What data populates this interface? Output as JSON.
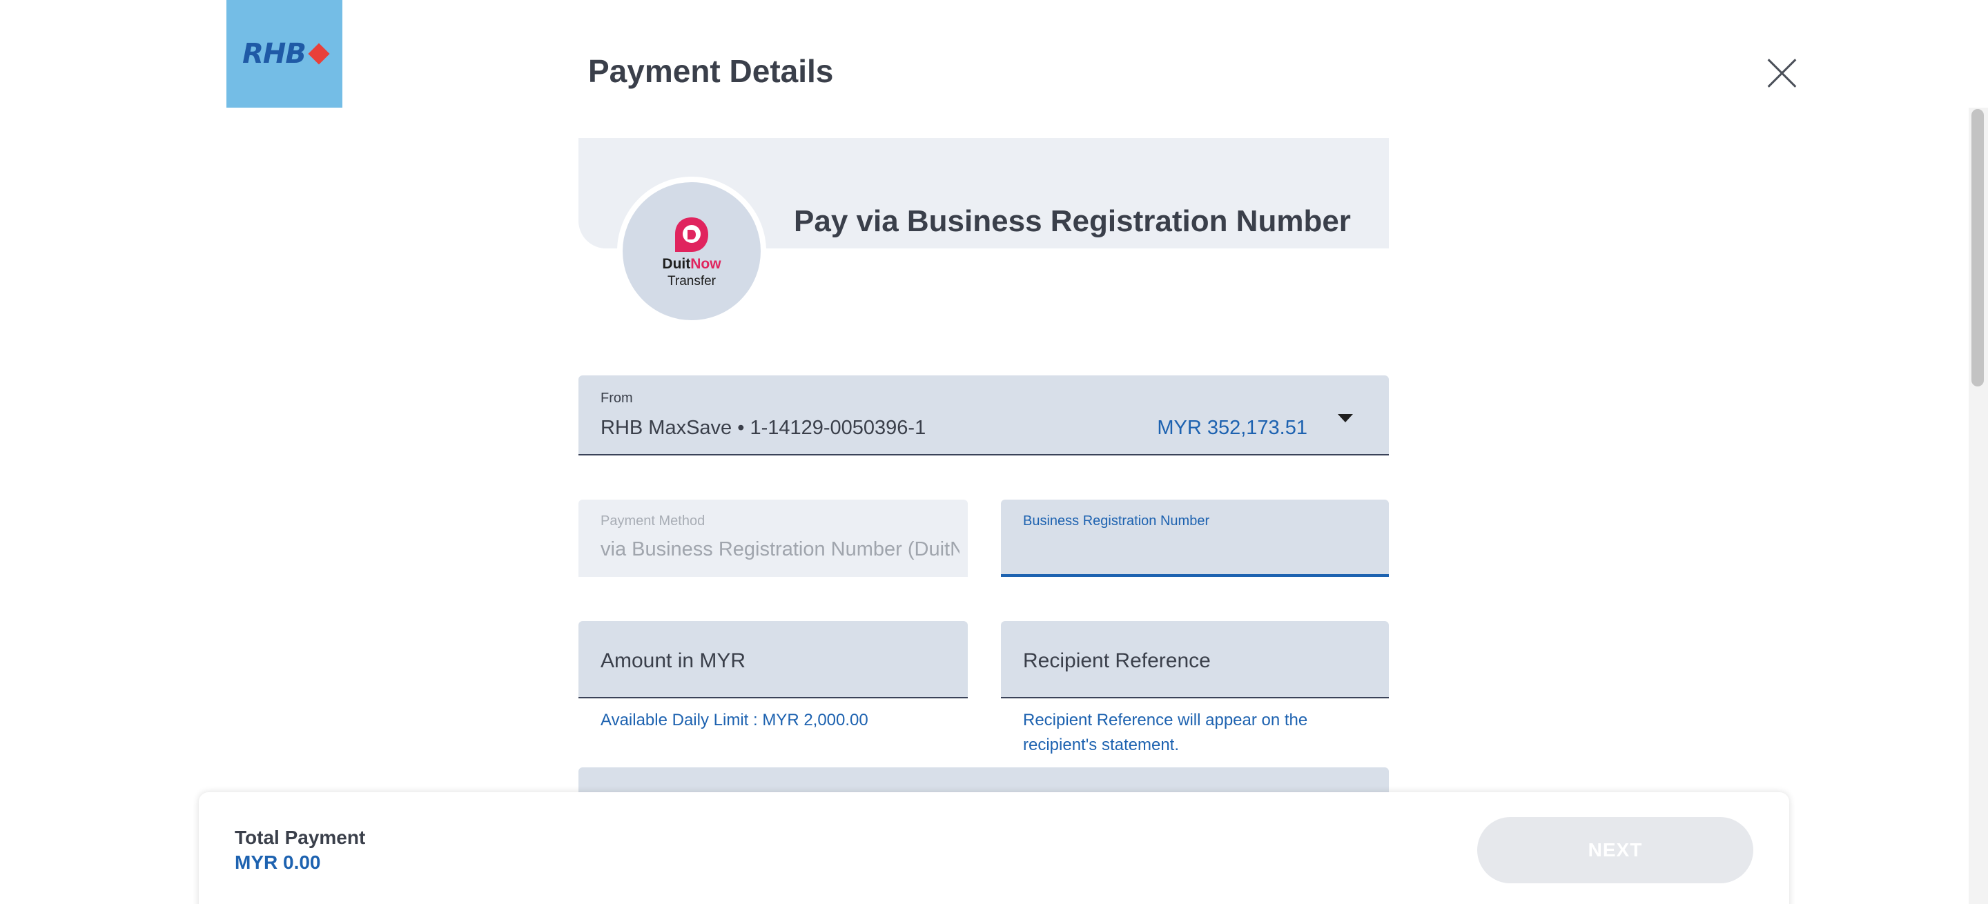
{
  "header": {
    "logo_text": "RHB",
    "title": "Payment Details",
    "close_icon": "close-icon"
  },
  "banner": {
    "title": "Pay via Business Registration Number",
    "duitnow": {
      "brand_first": "Duit",
      "brand_second": "Now",
      "subtitle": "Transfer",
      "accent_color": "#e0245e"
    }
  },
  "form": {
    "from": {
      "label": "From",
      "account": "RHB MaxSave • 1-14129-0050396-1",
      "balance": "MYR 352,173.51"
    },
    "payment_method": {
      "label": "Payment Method",
      "value": "via Business Registration Number (DuitN"
    },
    "brn": {
      "label": "Business Registration Number",
      "value": ""
    },
    "amount": {
      "placeholder": "Amount in MYR",
      "helper": "Available Daily Limit : MYR 2,000.00"
    },
    "reference": {
      "placeholder": "Recipient Reference",
      "helper": "Recipient Reference will appear on the recipient's statement."
    }
  },
  "footer": {
    "total_label": "Total Payment",
    "total_value": "MYR 0.00",
    "next_label": "NEXT"
  },
  "colors": {
    "brand_blue": "#1d62b0",
    "logo_bg": "#74bde6",
    "logo_diamond": "#e8403a",
    "field_bg": "#d8dfe9"
  }
}
